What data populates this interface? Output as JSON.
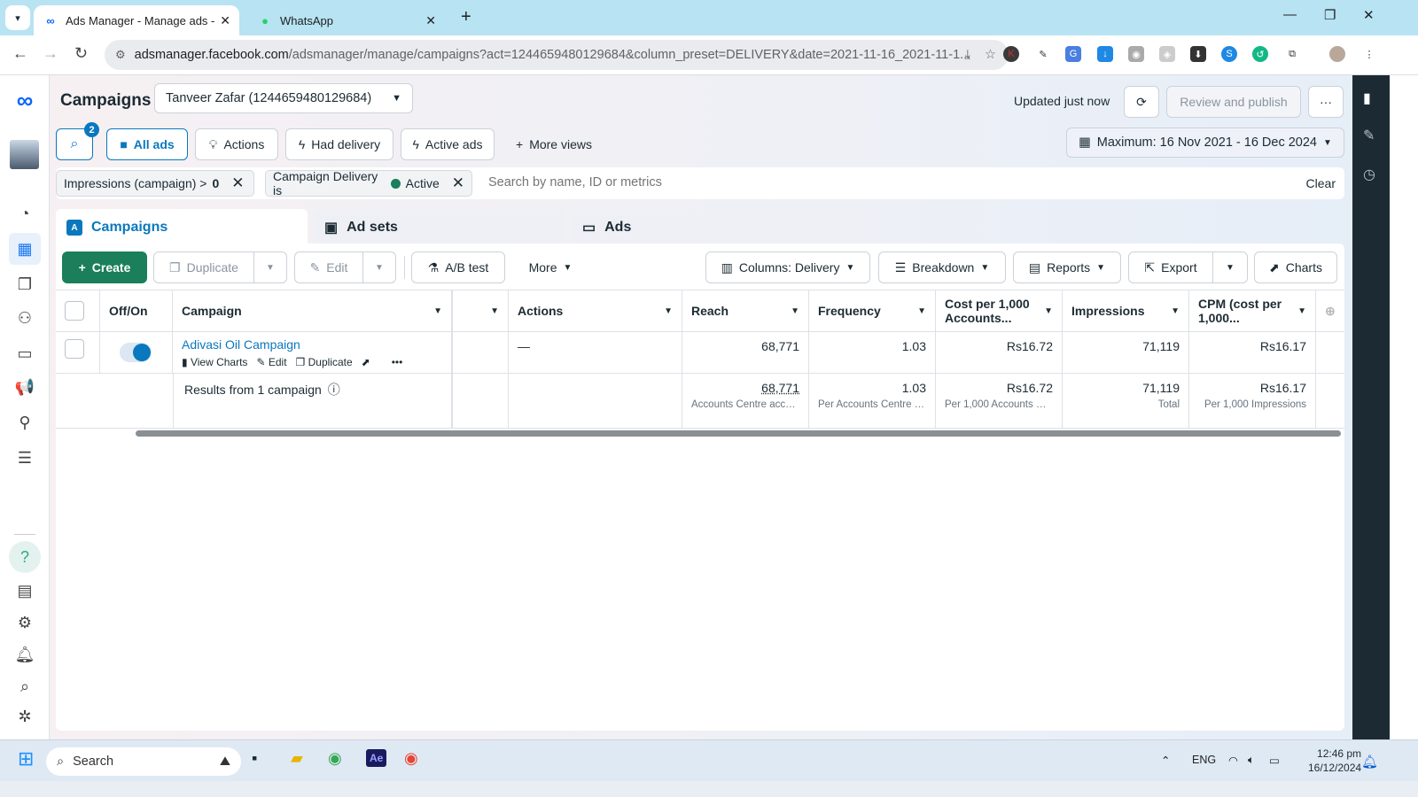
{
  "browser": {
    "tabs": [
      {
        "title": "Ads Manager - Manage ads - C",
        "favicon": "meta-icon",
        "active": true
      },
      {
        "title": "WhatsApp",
        "favicon": "whatsapp-icon",
        "active": false
      }
    ],
    "url_host": "adsmanager.facebook.com",
    "url_path": "/adsmanager/manage/campaigns?act=1244659480129684&column_preset=DELIVERY&date=2021-11-16_2021-11-1..."
  },
  "header": {
    "title": "Campaigns",
    "account": "Tanveer Zafar (1244659480129684)",
    "updated": "Updated just now",
    "review_publish": "Review and publish",
    "more": "···",
    "date_range": "Maximum: 16 Nov 2021 - 16 Dec 2024"
  },
  "views": {
    "search_badge": "2",
    "all_ads": "All ads",
    "actions": "Actions",
    "had_delivery": "Had delivery",
    "active_ads": "Active ads",
    "more_views": "More views"
  },
  "filters": {
    "chip1_label": "Impressions (campaign) >",
    "chip1_value": "0",
    "chip2_label": "Campaign Delivery is",
    "chip2_value": "Active",
    "search_placeholder": "Search by name, ID or metrics",
    "clear": "Clear"
  },
  "level_tabs": {
    "campaigns": "Campaigns",
    "ad_sets": "Ad sets",
    "ads": "Ads"
  },
  "toolbar": {
    "create": "Create",
    "duplicate": "Duplicate",
    "edit": "Edit",
    "ab_test": "A/B test",
    "more": "More",
    "columns": "Columns: Delivery",
    "breakdown": "Breakdown",
    "reports": "Reports",
    "export": "Export",
    "charts": "Charts"
  },
  "table": {
    "headers": {
      "off_on": "Off/On",
      "campaign": "Campaign",
      "blank": "",
      "actions": "Actions",
      "reach": "Reach",
      "frequency": "Frequency",
      "cost_per_1000": "Cost per 1,000 Accounts...",
      "impressions": "Impressions",
      "cpm": "CPM (cost per 1,000..."
    },
    "rows": [
      {
        "name": "Adivasi Oil Campaign",
        "enabled": true,
        "row_actions": [
          "View Charts",
          "Edit",
          "Duplicate"
        ],
        "actions": "—",
        "reach": "68,771",
        "frequency": "1.03",
        "cost_per_1000": "Rs16.72",
        "impressions": "71,119",
        "cpm": "Rs16.17"
      }
    ],
    "summary": {
      "label": "Results from 1 campaign",
      "reach": "68,771",
      "reach_sub": "Accounts Centre acco...",
      "frequency": "1.03",
      "frequency_sub": "Per Accounts Centre a...",
      "cost_per_1000": "Rs16.72",
      "cost_per_1000_sub": "Per 1,000 Accounts Ce...",
      "impressions": "71,119",
      "impressions_sub": "Total",
      "cpm": "Rs16.17",
      "cpm_sub": "Per 1,000 Impressions"
    }
  },
  "taskbar": {
    "search": "Search",
    "lang": "ENG",
    "time": "12:46 pm",
    "date": "16/12/2024"
  }
}
